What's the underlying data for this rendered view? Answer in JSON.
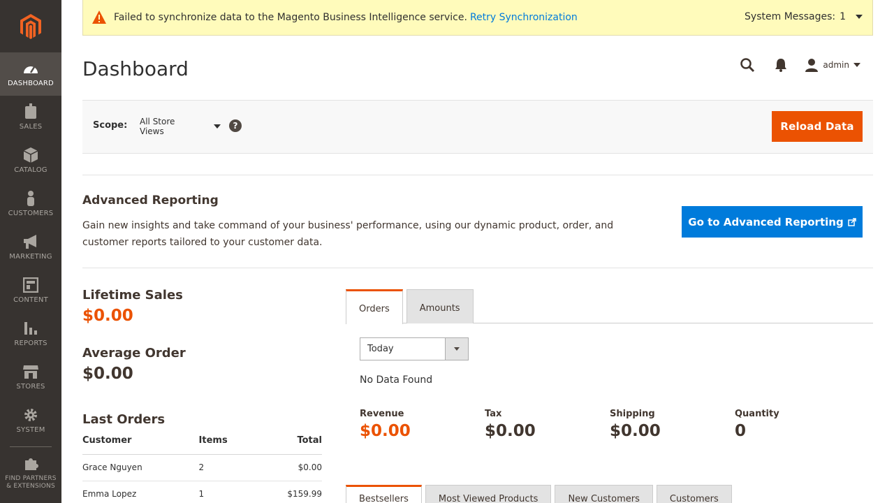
{
  "sidebar": {
    "logo": "magento-logo",
    "items": [
      {
        "label": "Dashboard",
        "icon": "dashboard-icon",
        "active": true
      },
      {
        "label": "Sales",
        "icon": "dollar-icon"
      },
      {
        "label": "Catalog",
        "icon": "box-icon"
      },
      {
        "label": "Customers",
        "icon": "person-icon"
      },
      {
        "label": "Marketing",
        "icon": "megaphone-icon"
      },
      {
        "label": "Content",
        "icon": "layout-icon"
      },
      {
        "label": "Reports",
        "icon": "bar-chart-icon"
      },
      {
        "label": "Stores",
        "icon": "storefront-icon"
      },
      {
        "label": "System",
        "icon": "gear-icon"
      },
      {
        "label": "Find Partners & Extensions",
        "icon": "puzzle-icon"
      }
    ]
  },
  "system_message": {
    "text": "Failed to synchronize data to the Magento Business Intelligence service.",
    "link": "Retry Synchronization",
    "messages_label": "System Messages:",
    "messages_count": "1"
  },
  "header": {
    "title": "Dashboard",
    "user": "admin"
  },
  "scope": {
    "label": "Scope:",
    "value": "All Store Views",
    "help": "?",
    "reload_label": "Reload Data"
  },
  "advanced_reporting": {
    "title": "Advanced Reporting",
    "text": "Gain new insights and take command of your business' performance, using our dynamic product, order, and customer reports tailored to your customer data.",
    "button": "Go to Advanced Reporting"
  },
  "totals": {
    "lifetime_label": "Lifetime Sales",
    "lifetime_value": "$0.00",
    "average_label": "Average Order",
    "average_value": "$0.00"
  },
  "last_orders": {
    "title": "Last Orders",
    "columns": [
      "Customer",
      "Items",
      "Total"
    ],
    "rows": [
      {
        "customer": "Grace Nguyen",
        "items": "2",
        "total": "$0.00"
      },
      {
        "customer": "Emma Lopez",
        "items": "1",
        "total": "$159.99"
      }
    ]
  },
  "chart_tabs": {
    "tabs": [
      "Orders",
      "Amounts"
    ],
    "period": "Today",
    "no_data": "No Data Found"
  },
  "metrics": [
    {
      "label": "Revenue",
      "value": "$0.00"
    },
    {
      "label": "Tax",
      "value": "$0.00"
    },
    {
      "label": "Shipping",
      "value": "$0.00"
    },
    {
      "label": "Quantity",
      "value": "0"
    }
  ],
  "grid_tabs": [
    "Bestsellers",
    "Most Viewed Products",
    "New Customers",
    "Customers"
  ],
  "colors": {
    "accent": "#eb5202",
    "link": "#007bdb",
    "sidebar": "#373330"
  }
}
